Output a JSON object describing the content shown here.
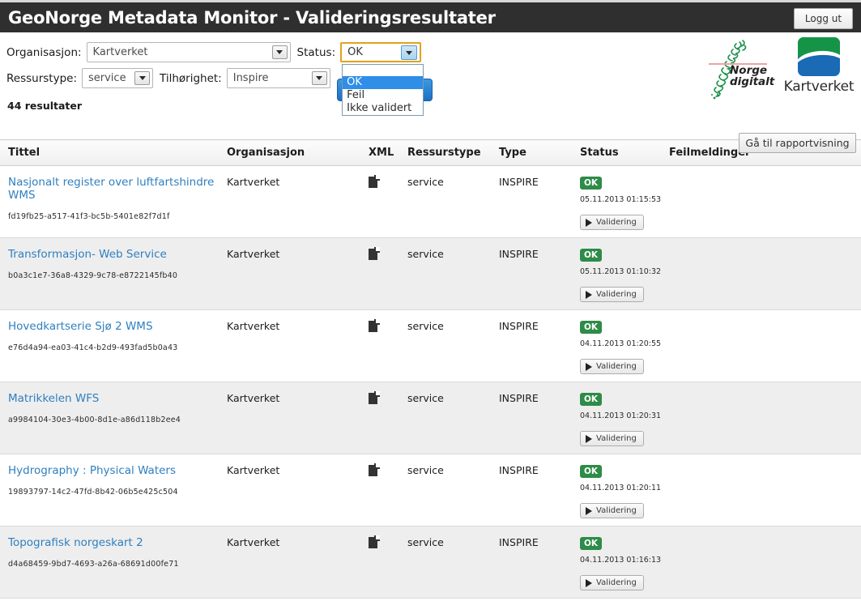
{
  "header": {
    "title": "GeoNorge Metadata Monitor - Valideringsresultater",
    "logout_label": "Logg ut"
  },
  "filters": {
    "organisasjon_label": "Organisasjon:",
    "organisasjon_value": "Kartverket",
    "status_label": "Status:",
    "status_value": "OK",
    "ressurstype_label": "Ressurstype:",
    "ressurstype_value": "service",
    "tilhorighet_label": "Tilhørighet:",
    "tilhorighet_value": "Inspire",
    "status_options": [
      "",
      "OK",
      "Feil",
      "Ikke validert"
    ],
    "results_count": "44 resultater",
    "report_button_label": "Gå til rapportvisning"
  },
  "branding": {
    "norge_digitalt_line1": "Norge",
    "norge_digitalt_line2": "digitalt",
    "kartverket_label": "Kartverket"
  },
  "table": {
    "columns": [
      "Tittel",
      "Organisasjon",
      "XML",
      "Ressurstype",
      "Type",
      "Status",
      "Feilmeldinger"
    ],
    "validering_label": "Validering",
    "rows": [
      {
        "tittel": "Nasjonalt register over luftfartshindre WMS",
        "uuid": "fd19fb25-a517-41f3-bc5b-5401e82f7d1f",
        "organisasjon": "Kartverket",
        "ressurstype": "service",
        "type": "INSPIRE",
        "status": "OK",
        "timestamp": "05.11.2013 01:15:53",
        "feilmeldinger": ""
      },
      {
        "tittel": "Transformasjon- Web Service",
        "uuid": "b0a3c1e7-36a8-4329-9c78-e8722145fb40",
        "organisasjon": "Kartverket",
        "ressurstype": "service",
        "type": "INSPIRE",
        "status": "OK",
        "timestamp": "05.11.2013 01:10:32",
        "feilmeldinger": ""
      },
      {
        "tittel": "Hovedkartserie Sjø 2 WMS",
        "uuid": "e76d4a94-ea03-41c4-b2d9-493fad5b0a43",
        "organisasjon": "Kartverket",
        "ressurstype": "service",
        "type": "INSPIRE",
        "status": "OK",
        "timestamp": "04.11.2013 01:20:55",
        "feilmeldinger": ""
      },
      {
        "tittel": "Matrikkelen WFS",
        "uuid": "a9984104-30e3-4b00-8d1e-a86d118b2ee4",
        "organisasjon": "Kartverket",
        "ressurstype": "service",
        "type": "INSPIRE",
        "status": "OK",
        "timestamp": "04.11.2013 01:20:31",
        "feilmeldinger": ""
      },
      {
        "tittel": "Hydrography : Physical Waters",
        "uuid": "19893797-14c2-47fd-8b42-06b5e425c504",
        "organisasjon": "Kartverket",
        "ressurstype": "service",
        "type": "INSPIRE",
        "status": "OK",
        "timestamp": "04.11.2013 01:20:11",
        "feilmeldinger": ""
      },
      {
        "tittel": "Topografisk norgeskart 2",
        "uuid": "d4a68459-9bd7-4693-a26a-68691d00fe71",
        "organisasjon": "Kartverket",
        "ressurstype": "service",
        "type": "INSPIRE",
        "status": "OK",
        "timestamp": "04.11.2013 01:16:13",
        "feilmeldinger": ""
      }
    ]
  },
  "colors": {
    "topbar": "#2f2f2f",
    "status_ok": "#2e8b48",
    "link": "#2f7fbf",
    "dropdown_highlight": "#2e8ee8",
    "focus_outline": "#e3a21a"
  }
}
